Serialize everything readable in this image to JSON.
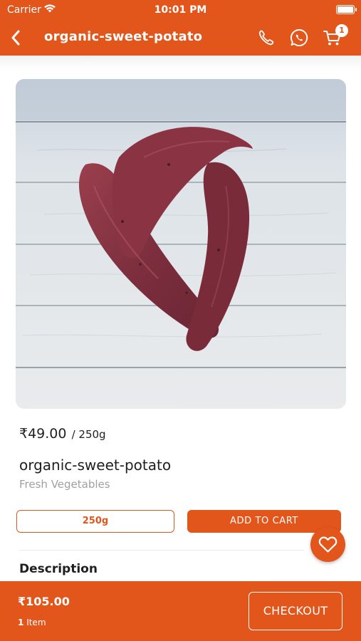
{
  "status_bar": {
    "carrier": "Carrier",
    "time": "10:01 PM"
  },
  "header": {
    "title": "organic-sweet-potato",
    "icons": [
      "back-chevron-icon",
      "phone-icon",
      "whatsapp-icon",
      "cart-icon"
    ],
    "cart_count": "1"
  },
  "product": {
    "image": "sweet-potatoes-photo",
    "price": "₹49.00",
    "unit": "/ 250g",
    "name": "organic-sweet-potato",
    "category": "Fresh Vegetables",
    "selected_variant": "250g",
    "add_to_cart_label": "ADD TO CART",
    "description_title": "Description"
  },
  "cart_summary": {
    "total": "₹105.00",
    "item_count": "1",
    "item_label": "Item",
    "checkout_label": "CHECKOUT"
  },
  "colors": {
    "accent": "#e2561b",
    "background": "#ffffff",
    "muted_text": "#a0a0a0"
  }
}
